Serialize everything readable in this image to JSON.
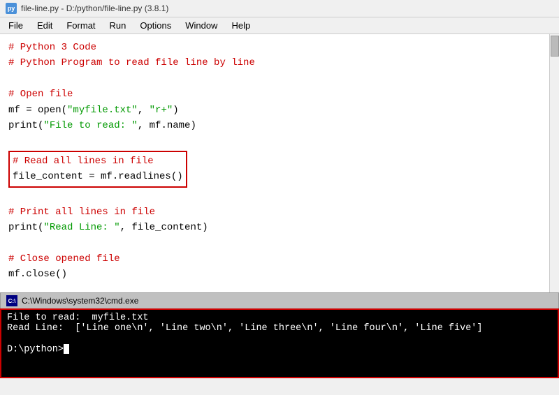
{
  "titlebar": {
    "icon": "py",
    "text": "file-line.py - D:/python/file-line.py (3.8.1)"
  },
  "menubar": {
    "items": [
      "File",
      "Edit",
      "Format",
      "Run",
      "Options",
      "Window",
      "Help"
    ]
  },
  "editor": {
    "lines": [
      {
        "type": "comment",
        "text": "# Python 3 Code"
      },
      {
        "type": "comment",
        "text": "# Python Program to read file line by line"
      },
      {
        "type": "empty",
        "text": ""
      },
      {
        "type": "comment",
        "text": "# Open file"
      },
      {
        "type": "code",
        "text": "mf = open(\"myfile.txt\", \"r+\")"
      },
      {
        "type": "code",
        "text": "print(\"File to read: \", mf.name)"
      },
      {
        "type": "empty",
        "text": ""
      },
      {
        "type": "highlight_comment",
        "text": "# Read all lines in file"
      },
      {
        "type": "highlight_code",
        "text": "file_content = mf.readlines()"
      },
      {
        "type": "empty",
        "text": ""
      },
      {
        "type": "comment",
        "text": "# Print all lines in file"
      },
      {
        "type": "code",
        "text": "print(\"Read Line: \", file_content)"
      },
      {
        "type": "empty",
        "text": ""
      },
      {
        "type": "comment",
        "text": "# Close opened file"
      },
      {
        "type": "code",
        "text": "mf.close()"
      }
    ]
  },
  "terminal": {
    "title": "C:\\Windows\\system32\\cmd.exe",
    "lines": [
      "File to read:  myfile.txt",
      "Read Line:  ['Line one\\n', 'Line two\\n', 'Line three\\n', 'Line four\\n', 'Line five']",
      "",
      "D:\\python>_"
    ]
  }
}
